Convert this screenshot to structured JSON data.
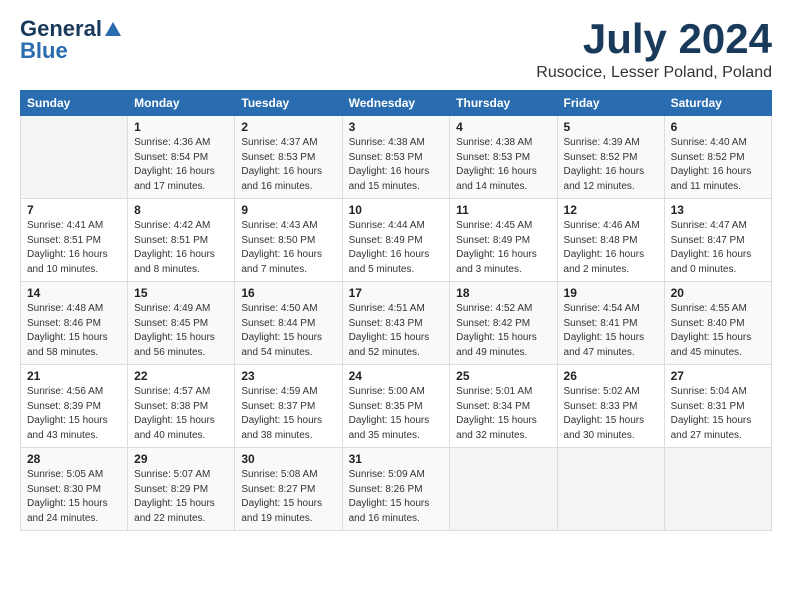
{
  "header": {
    "logo_general": "General",
    "logo_blue": "Blue",
    "month_title": "July 2024",
    "location": "Rusocice, Lesser Poland, Poland"
  },
  "calendar": {
    "days_of_week": [
      "Sunday",
      "Monday",
      "Tuesday",
      "Wednesday",
      "Thursday",
      "Friday",
      "Saturday"
    ],
    "weeks": [
      [
        {
          "day": "",
          "details": ""
        },
        {
          "day": "1",
          "details": "Sunrise: 4:36 AM\nSunset: 8:54 PM\nDaylight: 16 hours\nand 17 minutes."
        },
        {
          "day": "2",
          "details": "Sunrise: 4:37 AM\nSunset: 8:53 PM\nDaylight: 16 hours\nand 16 minutes."
        },
        {
          "day": "3",
          "details": "Sunrise: 4:38 AM\nSunset: 8:53 PM\nDaylight: 16 hours\nand 15 minutes."
        },
        {
          "day": "4",
          "details": "Sunrise: 4:38 AM\nSunset: 8:53 PM\nDaylight: 16 hours\nand 14 minutes."
        },
        {
          "day": "5",
          "details": "Sunrise: 4:39 AM\nSunset: 8:52 PM\nDaylight: 16 hours\nand 12 minutes."
        },
        {
          "day": "6",
          "details": "Sunrise: 4:40 AM\nSunset: 8:52 PM\nDaylight: 16 hours\nand 11 minutes."
        }
      ],
      [
        {
          "day": "7",
          "details": "Sunrise: 4:41 AM\nSunset: 8:51 PM\nDaylight: 16 hours\nand 10 minutes."
        },
        {
          "day": "8",
          "details": "Sunrise: 4:42 AM\nSunset: 8:51 PM\nDaylight: 16 hours\nand 8 minutes."
        },
        {
          "day": "9",
          "details": "Sunrise: 4:43 AM\nSunset: 8:50 PM\nDaylight: 16 hours\nand 7 minutes."
        },
        {
          "day": "10",
          "details": "Sunrise: 4:44 AM\nSunset: 8:49 PM\nDaylight: 16 hours\nand 5 minutes."
        },
        {
          "day": "11",
          "details": "Sunrise: 4:45 AM\nSunset: 8:49 PM\nDaylight: 16 hours\nand 3 minutes."
        },
        {
          "day": "12",
          "details": "Sunrise: 4:46 AM\nSunset: 8:48 PM\nDaylight: 16 hours\nand 2 minutes."
        },
        {
          "day": "13",
          "details": "Sunrise: 4:47 AM\nSunset: 8:47 PM\nDaylight: 16 hours\nand 0 minutes."
        }
      ],
      [
        {
          "day": "14",
          "details": "Sunrise: 4:48 AM\nSunset: 8:46 PM\nDaylight: 15 hours\nand 58 minutes."
        },
        {
          "day": "15",
          "details": "Sunrise: 4:49 AM\nSunset: 8:45 PM\nDaylight: 15 hours\nand 56 minutes."
        },
        {
          "day": "16",
          "details": "Sunrise: 4:50 AM\nSunset: 8:44 PM\nDaylight: 15 hours\nand 54 minutes."
        },
        {
          "day": "17",
          "details": "Sunrise: 4:51 AM\nSunset: 8:43 PM\nDaylight: 15 hours\nand 52 minutes."
        },
        {
          "day": "18",
          "details": "Sunrise: 4:52 AM\nSunset: 8:42 PM\nDaylight: 15 hours\nand 49 minutes."
        },
        {
          "day": "19",
          "details": "Sunrise: 4:54 AM\nSunset: 8:41 PM\nDaylight: 15 hours\nand 47 minutes."
        },
        {
          "day": "20",
          "details": "Sunrise: 4:55 AM\nSunset: 8:40 PM\nDaylight: 15 hours\nand 45 minutes."
        }
      ],
      [
        {
          "day": "21",
          "details": "Sunrise: 4:56 AM\nSunset: 8:39 PM\nDaylight: 15 hours\nand 43 minutes."
        },
        {
          "day": "22",
          "details": "Sunrise: 4:57 AM\nSunset: 8:38 PM\nDaylight: 15 hours\nand 40 minutes."
        },
        {
          "day": "23",
          "details": "Sunrise: 4:59 AM\nSunset: 8:37 PM\nDaylight: 15 hours\nand 38 minutes."
        },
        {
          "day": "24",
          "details": "Sunrise: 5:00 AM\nSunset: 8:35 PM\nDaylight: 15 hours\nand 35 minutes."
        },
        {
          "day": "25",
          "details": "Sunrise: 5:01 AM\nSunset: 8:34 PM\nDaylight: 15 hours\nand 32 minutes."
        },
        {
          "day": "26",
          "details": "Sunrise: 5:02 AM\nSunset: 8:33 PM\nDaylight: 15 hours\nand 30 minutes."
        },
        {
          "day": "27",
          "details": "Sunrise: 5:04 AM\nSunset: 8:31 PM\nDaylight: 15 hours\nand 27 minutes."
        }
      ],
      [
        {
          "day": "28",
          "details": "Sunrise: 5:05 AM\nSunset: 8:30 PM\nDaylight: 15 hours\nand 24 minutes."
        },
        {
          "day": "29",
          "details": "Sunrise: 5:07 AM\nSunset: 8:29 PM\nDaylight: 15 hours\nand 22 minutes."
        },
        {
          "day": "30",
          "details": "Sunrise: 5:08 AM\nSunset: 8:27 PM\nDaylight: 15 hours\nand 19 minutes."
        },
        {
          "day": "31",
          "details": "Sunrise: 5:09 AM\nSunset: 8:26 PM\nDaylight: 15 hours\nand 16 minutes."
        },
        {
          "day": "",
          "details": ""
        },
        {
          "day": "",
          "details": ""
        },
        {
          "day": "",
          "details": ""
        }
      ]
    ]
  }
}
